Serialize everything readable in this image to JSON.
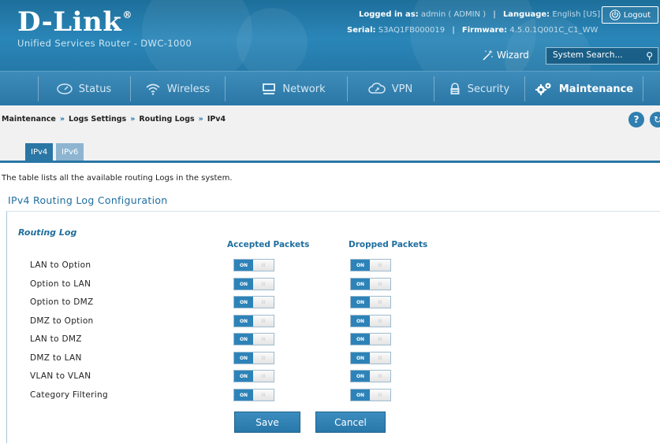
{
  "header": {
    "brand": "D-Link",
    "brand_mark": "®",
    "product": "Unified Services Router - DWC-1000",
    "logged_in_label": "Logged in as:",
    "logged_in_value": "admin ( ADMIN )",
    "language_label": "Language:",
    "language_value": "English [US]",
    "serial_label": "Serial:",
    "serial_value": "S3AQ1FB000019",
    "firmware_label": "Firmware:",
    "firmware_value": "4.5.0.1Q001C_C1_WW",
    "logout_label": "Logout",
    "wizard_label": "Wizard",
    "search_placeholder": "System Search...",
    "colors": {
      "header_bg": "#2a86b8",
      "nav_bg": "#2a76a5",
      "accent": "#1e6e9e"
    }
  },
  "nav": {
    "items": [
      {
        "label": "Status",
        "icon": "gauge-icon"
      },
      {
        "label": "Wireless",
        "icon": "wifi-icon"
      },
      {
        "label": "Network",
        "icon": "monitor-icon"
      },
      {
        "label": "VPN",
        "icon": "cloud-icon"
      },
      {
        "label": "Security",
        "icon": "lock-icon"
      },
      {
        "label": "Maintenance",
        "icon": "gears-icon",
        "active": true
      }
    ]
  },
  "breadcrumb": {
    "items": [
      "Maintenance",
      "Logs Settings",
      "Routing Logs",
      "IPv4"
    ],
    "separator": "»"
  },
  "tabs": [
    {
      "label": "IPv4",
      "active": true
    },
    {
      "label": "IPv6",
      "active": false
    }
  ],
  "page": {
    "description": "The table lists all the available routing Logs in the system.",
    "section_title": "IPv4 Routing Log Configuration",
    "routing_log_title": "Routing Log",
    "col_accepted": "Accepted Packets",
    "col_dropped": "Dropped Packets",
    "toggle_on": "ON",
    "toggle_off": "III",
    "rows": [
      {
        "label": "LAN to Option",
        "accepted": "ON",
        "dropped": "ON"
      },
      {
        "label": "Option to LAN",
        "accepted": "ON",
        "dropped": "ON"
      },
      {
        "label": "Option to DMZ",
        "accepted": "ON",
        "dropped": "ON"
      },
      {
        "label": "DMZ to Option",
        "accepted": "ON",
        "dropped": "ON"
      },
      {
        "label": "LAN to DMZ",
        "accepted": "ON",
        "dropped": "ON"
      },
      {
        "label": "DMZ to LAN",
        "accepted": "ON",
        "dropped": "ON"
      },
      {
        "label": "VLAN to VLAN",
        "accepted": "ON",
        "dropped": "ON"
      },
      {
        "label": "Category Filtering",
        "accepted": "ON",
        "dropped": "ON"
      }
    ],
    "save_label": "Save",
    "cancel_label": "Cancel"
  }
}
